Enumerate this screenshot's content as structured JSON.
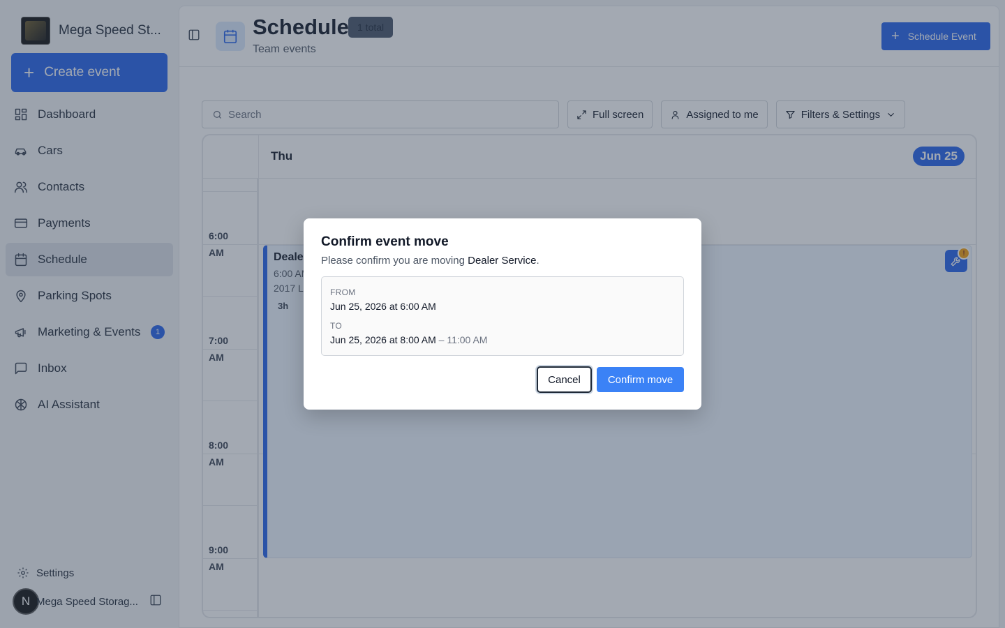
{
  "sidebar": {
    "brand_name": "Mega Speed St...",
    "create_label": "Create event",
    "items": [
      {
        "label": "Dashboard",
        "icon": "dashboard-icon"
      },
      {
        "label": "Cars",
        "icon": "car-icon"
      },
      {
        "label": "Contacts",
        "icon": "contacts-icon"
      },
      {
        "label": "Payments",
        "icon": "payments-icon"
      },
      {
        "label": "Schedule",
        "icon": "calendar-icon",
        "active": true
      },
      {
        "label": "Parking Spots",
        "icon": "map-pin-icon"
      },
      {
        "label": "Marketing & Events",
        "icon": "megaphone-icon",
        "badge": "1"
      },
      {
        "label": "Inbox",
        "icon": "inbox-icon"
      },
      {
        "label": "AI Assistant",
        "icon": "ai-icon"
      }
    ],
    "settings_label": "Settings",
    "user_initial": "N",
    "user_name": "Mega Speed Storag..."
  },
  "header": {
    "title": "Schedule",
    "total_badge": "1 total",
    "subtitle": "Team events",
    "schedule_button": "Schedule Event"
  },
  "toolbar": {
    "search_placeholder": "Search",
    "fullscreen_label": "Full screen",
    "assigned_label": "Assigned to me",
    "filters_label": "Filters & Settings"
  },
  "calendar": {
    "day_label": "Thu",
    "date_label": "Jun 25",
    "times": [
      {
        "hour": "6:00",
        "period": "AM"
      },
      {
        "hour": "7:00",
        "period": "AM"
      },
      {
        "hour": "8:00",
        "period": "AM"
      },
      {
        "hour": "9:00",
        "period": "AM"
      }
    ],
    "event": {
      "title": "Deale",
      "time": "6:00 AM",
      "car": "2017 L",
      "duration": "3h",
      "alert": "!"
    }
  },
  "modal": {
    "title": "Confirm event move",
    "description_prefix": "Please confirm you are moving ",
    "event_name": "Dealer Service",
    "description_suffix": ".",
    "from_label": "FROM",
    "from_value": "Jun 25, 2026 at 6:00 AM",
    "to_label": "TO",
    "to_value": "Jun 25, 2026 at 8:00 AM",
    "to_end": "– 11:00 AM",
    "cancel_label": "Cancel",
    "confirm_label": "Confirm move"
  },
  "colors": {
    "accent": "#2563eb",
    "confirm": "#3b82f6",
    "overlay": "#334155",
    "alert": "#f59e0b"
  }
}
